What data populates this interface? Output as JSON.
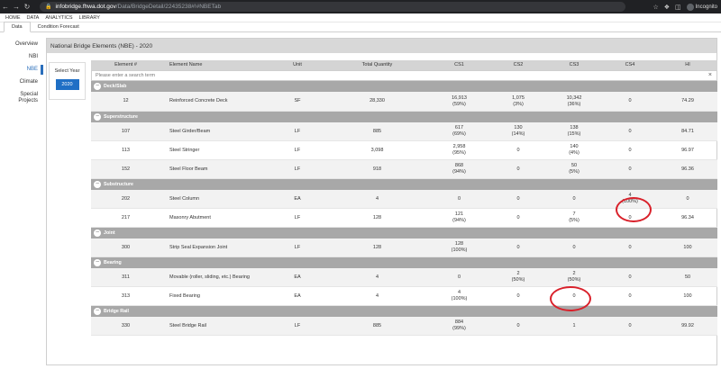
{
  "browser": {
    "url_host": "infobridge.fhwa.dot.gov",
    "url_path": "/Data/BridgeDetail/22435238#!#NBETab",
    "profile": "Incognito"
  },
  "top_nav": [
    "HOME",
    "DATA",
    "ANALYTICS",
    "LIBRARY"
  ],
  "sub_tabs": [
    "Data",
    "Condition Forecast"
  ],
  "sidebar": [
    "Overview",
    "NBI",
    "NBE",
    "Climate",
    "Special Projects"
  ],
  "panel_title": "National Bridge Elements (NBE) - 2020",
  "year_selector": {
    "label": "Select Year",
    "selected": "2020"
  },
  "columns": [
    "Element #",
    "Element Name",
    "Unit",
    "Total Quantity",
    "CS1",
    "CS2",
    "CS3",
    "CS4",
    "HI"
  ],
  "search_placeholder": "Please enter a search term",
  "groups": [
    {
      "name": "Deck/Slab",
      "rows": [
        {
          "element": "12",
          "name": "Reinforced Concrete Deck",
          "unit": "SF",
          "total": "28,330",
          "cs1": "16,913",
          "cs1p": "(59%)",
          "cs2": "1,075",
          "cs2p": "(3%)",
          "cs3": "10,342",
          "cs3p": "(36%)",
          "cs4": "0",
          "cs4p": "",
          "hi": "74.29"
        }
      ]
    },
    {
      "name": "Superstructure",
      "rows": [
        {
          "element": "107",
          "name": "Steel Girder/Beam",
          "unit": "LF",
          "total": "885",
          "cs1": "617",
          "cs1p": "(69%)",
          "cs2": "130",
          "cs2p": "(14%)",
          "cs3": "138",
          "cs3p": "(15%)",
          "cs4": "0",
          "cs4p": "",
          "hi": "84.71"
        },
        {
          "element": "113",
          "name": "Steel Stringer",
          "unit": "LF",
          "total": "3,098",
          "cs1": "2,958",
          "cs1p": "(95%)",
          "cs2": "0",
          "cs2p": "",
          "cs3": "140",
          "cs3p": "(4%)",
          "cs4": "0",
          "cs4p": "",
          "hi": "96.97"
        },
        {
          "element": "152",
          "name": "Steel Floor Beam",
          "unit": "LF",
          "total": "918",
          "cs1": "868",
          "cs1p": "(94%)",
          "cs2": "0",
          "cs2p": "",
          "cs3": "50",
          "cs3p": "(5%)",
          "cs4": "0",
          "cs4p": "",
          "hi": "96.36"
        }
      ]
    },
    {
      "name": "Substructure",
      "rows": [
        {
          "element": "202",
          "name": "Steel Column",
          "unit": "EA",
          "total": "4",
          "cs1": "0",
          "cs1p": "",
          "cs2": "0",
          "cs2p": "",
          "cs3": "0",
          "cs3p": "",
          "cs4": "4",
          "cs4p": "(100%)",
          "hi": "0"
        },
        {
          "element": "217",
          "name": "Masonry Abutment",
          "unit": "LF",
          "total": "128",
          "cs1": "121",
          "cs1p": "(94%)",
          "cs2": "0",
          "cs2p": "",
          "cs3": "7",
          "cs3p": "(5%)",
          "cs4": "0",
          "cs4p": "",
          "hi": "96.34"
        }
      ]
    },
    {
      "name": "Joint",
      "rows": [
        {
          "element": "300",
          "name": "Strip Seal Expansion Joint",
          "unit": "LF",
          "total": "128",
          "cs1": "128",
          "cs1p": "(100%)",
          "cs2": "0",
          "cs2p": "",
          "cs3": "0",
          "cs3p": "",
          "cs4": "0",
          "cs4p": "",
          "hi": "100"
        }
      ]
    },
    {
      "name": "Bearing",
      "rows": [
        {
          "element": "311",
          "name": "Movable (roller, sliding, etc.) Bearing",
          "unit": "EA",
          "total": "4",
          "cs1": "0",
          "cs1p": "",
          "cs2": "2",
          "cs2p": "(50%)",
          "cs3": "2",
          "cs3p": "(50%)",
          "cs4": "0",
          "cs4p": "",
          "hi": "50"
        },
        {
          "element": "313",
          "name": "Fixed Bearing",
          "unit": "EA",
          "total": "4",
          "cs1": "4",
          "cs1p": "(100%)",
          "cs2": "0",
          "cs2p": "",
          "cs3": "0",
          "cs3p": "",
          "cs4": "0",
          "cs4p": "",
          "hi": "100"
        }
      ]
    },
    {
      "name": "Bridge Rail",
      "rows": [
        {
          "element": "330",
          "name": "Steel Bridge Rail",
          "unit": "LF",
          "total": "885",
          "cs1": "884",
          "cs1p": "(99%)",
          "cs2": "0",
          "cs2p": "",
          "cs3": "1",
          "cs3p": "",
          "cs4": "0",
          "cs4p": "",
          "hi": "99.92"
        }
      ]
    }
  ],
  "annotation_color": "#d9202a"
}
